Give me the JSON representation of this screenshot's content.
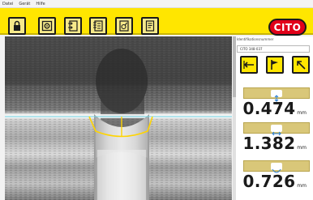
{
  "menu": [
    "Datei",
    "Gerät",
    "Hilfe"
  ],
  "toolbar": {
    "buttons": [
      {
        "icon": "lock-icon"
      },
      {
        "icon": "target-icon"
      },
      {
        "icon": "document-arrows-icon"
      },
      {
        "icon": "document-list-icon"
      },
      {
        "icon": "measure-document-icon"
      },
      {
        "icon": "note-document-icon"
      }
    ],
    "logo_text": "CITO"
  },
  "sidebar": {
    "id_label": "Identifikationsnummer",
    "id_value": "CITO 348-037",
    "tools": [
      {
        "icon": "arrow-left-measure-icon"
      },
      {
        "icon": "flag-icon"
      },
      {
        "icon": "arrow-diagonal-icon"
      }
    ],
    "measurements": [
      {
        "value": "0.474",
        "unit": "mm",
        "icon": "depth-icon"
      },
      {
        "value": "1.382",
        "unit": "mm",
        "icon": "width-icon"
      },
      {
        "value": "0.726",
        "unit": "mm",
        "icon": "radius-icon"
      }
    ]
  },
  "colors": {
    "toolbar": "#ffe600",
    "logo": "#e10019",
    "measure_line": "#ffd400",
    "surface_line": "#6fd6e6"
  }
}
